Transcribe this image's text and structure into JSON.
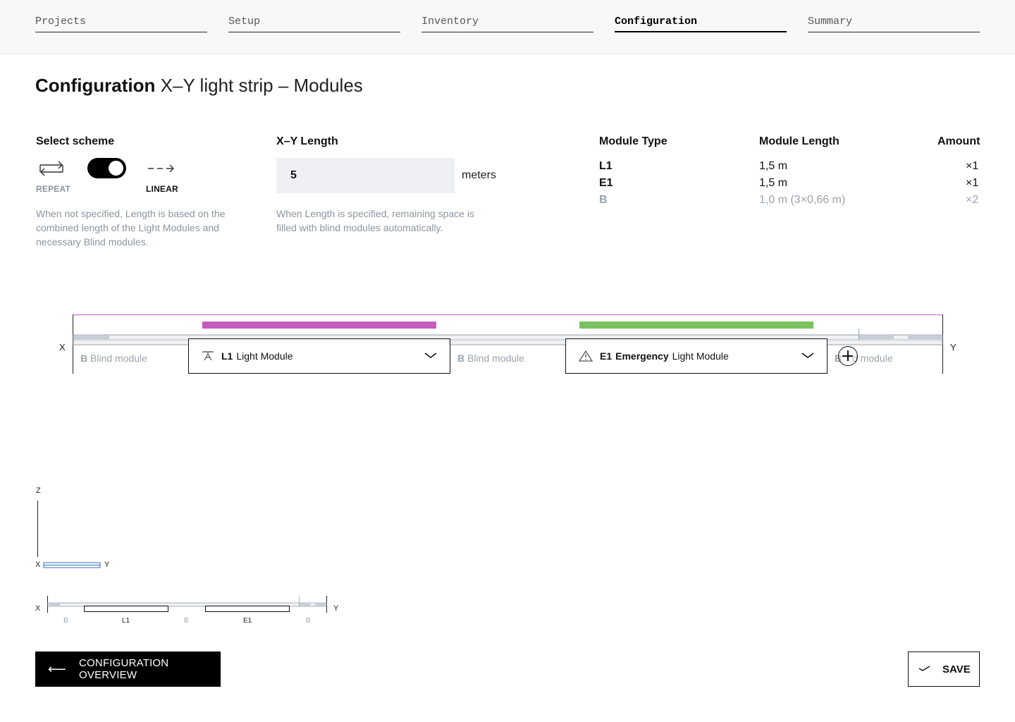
{
  "nav": {
    "steps": [
      "Projects",
      "Setup",
      "Inventory",
      "Configuration",
      "Summary"
    ]
  },
  "title": {
    "strong": "Configuration",
    "rest": "X–Y light strip – Modules"
  },
  "scheme": {
    "label": "Select scheme",
    "repeat": "REPEAT",
    "linear": "LINEAR",
    "help": "When not specified, Length is based on the combined length of the Light Modules and necessary Blind modules."
  },
  "length": {
    "label": "X–Y Length",
    "value": "5",
    "unit": "meters",
    "help": "When Length is specified, remaining space is filled with blind modules automatically."
  },
  "modules_table": {
    "headers": [
      "Module Type",
      "Module Length",
      "Amount"
    ],
    "rows": [
      {
        "type": "L1",
        "length": "1,5 m",
        "amount": "×1"
      },
      {
        "type": "E1",
        "length": "1,5 m",
        "amount": "×1"
      },
      {
        "type": "B",
        "length": "1,0 m (3×0,66 m)",
        "amount": "×2"
      }
    ]
  },
  "strip": {
    "x_label": "X",
    "y_label": "Y",
    "blind_code": "B",
    "blind_text": "Blind module",
    "blind_text_partial": "d module",
    "module1": {
      "code": "L1",
      "name": "Light Module",
      "icon": "light-module-icon",
      "bar_color": "#c55bbd"
    },
    "module2": {
      "code": "E1",
      "name_bold": "Emergency",
      "name": "Light Module",
      "icon": "emergency-module-icon",
      "bar_color": "#79c25f"
    }
  },
  "side_view": {
    "z": "Z",
    "x": "X",
    "y": "Y"
  },
  "mini_strip": {
    "x": "X",
    "y": "Y",
    "labels": [
      "B",
      "L1",
      "B",
      "E1",
      "B"
    ]
  },
  "buttons": {
    "overview": "CONFIGURATION OVERVIEW",
    "save": "SAVE"
  }
}
